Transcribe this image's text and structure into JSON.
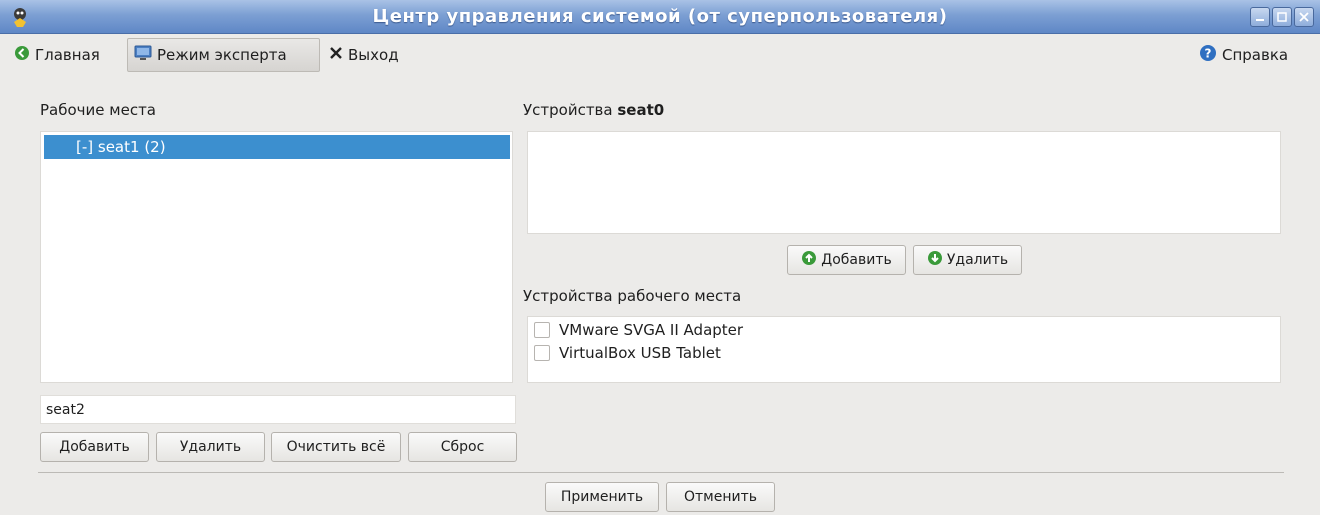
{
  "window": {
    "title": "Центр управления системой (от суперпользователя)"
  },
  "toolbar": {
    "home_label": "Главная",
    "expert_label": "Режим эксперта",
    "exit_label": "Выход",
    "help_label": "Справка"
  },
  "seats": {
    "heading": "Рабочие места",
    "items": [
      {
        "label": "[-] seat1 (2)",
        "selected": true
      }
    ],
    "name_input_value": "seat2",
    "buttons": {
      "add": "Добавить",
      "remove": "Удалить",
      "clear_all": "Очистить всё",
      "reset": "Сброс"
    }
  },
  "devices": {
    "heading_prefix": "Устройства",
    "heading_seat": "seat0",
    "items": [],
    "add_label": "Добавить",
    "remove_label": "Удалить"
  },
  "seat_devices": {
    "heading": "Устройства рабочего места",
    "items": [
      {
        "label": "VMware SVGA II Adapter",
        "checked": false
      },
      {
        "label": "VirtualBox USB Tablet",
        "checked": false
      }
    ]
  },
  "footer": {
    "apply_label": "Применить",
    "cancel_label": "Отменить"
  },
  "colors": {
    "title_bar": "#7c9fd3",
    "selection": "#3c8fcf",
    "add_icon": "#3a9a3a"
  }
}
